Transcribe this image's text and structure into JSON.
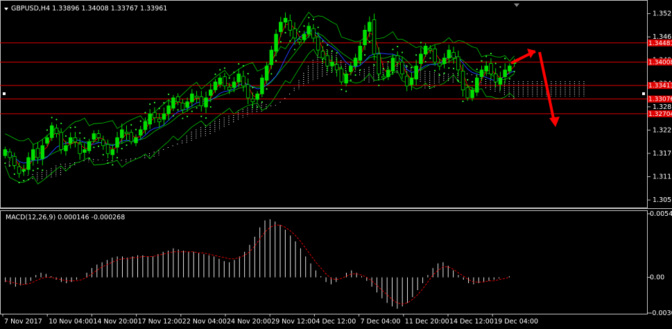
{
  "header": {
    "symbol_line": "GBPUSD,H4  1.33896 1.34008 1.33767 1.33961",
    "macd_line": "MACD(12,26,9) 0.000146 -0.000268"
  },
  "colors": {
    "background": "#000000",
    "frame": "#c8c8c8",
    "bull_candle": "#00e000",
    "bear_candle": "#000000",
    "candle_outline": "#00e000",
    "bollinger": "#00cc00",
    "parabolic_sar": "#33ff33",
    "ichimoku_cloud": "#f0f0f0",
    "ma_red": "#e00000",
    "ma_blue": "#2040ff",
    "level_lines": "#e00000",
    "level_tag_bg": "#e00000",
    "macd_hist": "#e8e8e8",
    "macd_signal": "#e00000",
    "arrows": "#ff0000"
  },
  "chart_data": [
    {
      "type": "candlestick",
      "title": "GBPUSD,H4",
      "ohlc_latest": {
        "open": 1.33896,
        "high": 1.34008,
        "low": 1.33767,
        "close": 1.33961
      },
      "y_ticks": [
        "1.35215",
        "1.34630",
        "1.34050",
        "1.33460",
        "1.32875",
        "1.32290",
        "1.31705",
        "1.31120",
        "1.30535"
      ],
      "ylim": [
        1.3038,
        1.3547
      ],
      "x_ticks": [
        "7 Nov 2017",
        "10 Nov 04:00",
        "14 Nov 20:00",
        "17 Nov 12:00",
        "22 Nov 04:00",
        "24 Nov 20:00",
        "29 Nov 12:00",
        "4 Dec 12:00",
        "7 Dec 04:00",
        "11 Dec 20:00",
        "14 Dec 12:00",
        "19 Dec 04:00"
      ],
      "horizontal_levels": [
        {
          "value": 1.3448,
          "label": "1.34481"
        },
        {
          "value": 1.34,
          "label": "1.34008"
        },
        {
          "value": 1.3341,
          "label": "1.33413"
        },
        {
          "value": 1.3307,
          "label": "1.33076"
        },
        {
          "value": 1.327,
          "label": "1.32704"
        }
      ],
      "close_path": [
        1.318,
        1.316,
        1.314,
        1.312,
        1.313,
        1.316,
        1.318,
        1.316,
        1.319,
        1.321,
        1.324,
        1.322,
        1.318,
        1.319,
        1.321,
        1.32,
        1.317,
        1.318,
        1.32,
        1.322,
        1.321,
        1.319,
        1.317,
        1.318,
        1.321,
        1.323,
        1.322,
        1.32,
        1.321,
        1.323,
        1.325,
        1.327,
        1.326,
        1.325,
        1.327,
        1.329,
        1.331,
        1.33,
        1.328,
        1.33,
        1.332,
        1.331,
        1.329,
        1.331,
        1.333,
        1.335,
        1.336,
        1.334,
        1.333,
        1.335,
        1.337,
        1.334,
        1.331,
        1.33,
        1.332,
        1.336,
        1.339,
        1.343,
        1.347,
        1.35,
        1.351,
        1.348,
        1.346,
        1.345,
        1.347,
        1.349,
        1.346,
        1.343,
        1.341,
        1.339,
        1.34,
        1.338,
        1.335,
        1.337,
        1.339,
        1.341,
        1.344,
        1.348,
        1.35,
        1.342,
        1.337,
        1.336,
        1.338,
        1.341,
        1.34,
        1.337,
        1.334,
        1.336,
        1.339,
        1.342,
        1.344,
        1.343,
        1.34,
        1.339,
        1.341,
        1.343,
        1.341,
        1.338,
        1.333,
        1.331,
        1.333,
        1.336,
        1.338,
        1.339,
        1.337,
        1.335,
        1.336,
        1.338,
        1.339,
        1.34
      ]
    },
    {
      "type": "bar",
      "title": "MACD(12,26,9)",
      "y_ticks": [
        "0.00547",
        "0.00",
        "-0.00307"
      ],
      "ylim": [
        -0.00307,
        0.00547
      ],
      "histogram": [
        -0.0004,
        -0.0006,
        -0.0008,
        -0.0007,
        -0.0006,
        -0.0003,
        0.0002,
        0.0004,
        0.0003,
        0.0001,
        -0.0002,
        -0.0004,
        -0.0005,
        -0.0004,
        -0.0002,
        0.0,
        0.0004,
        0.0008,
        0.0011,
        0.0013,
        0.0015,
        0.0017,
        0.0018,
        0.0018,
        0.0017,
        0.0018,
        0.0019,
        0.0019,
        0.0018,
        0.0018,
        0.002,
        0.0022,
        0.0023,
        0.0025,
        0.0024,
        0.0023,
        0.0022,
        0.0022,
        0.0021,
        0.002,
        0.0019,
        0.0018,
        0.0016,
        0.0014,
        0.0013,
        0.0015,
        0.0018,
        0.0022,
        0.0028,
        0.0035,
        0.0043,
        0.0049,
        0.005,
        0.0048,
        0.0045,
        0.0041,
        0.0036,
        0.0031,
        0.0025,
        0.0018,
        0.0012,
        0.0006,
        0.0001,
        -0.0004,
        -0.0006,
        -0.0004,
        0.0,
        0.0004,
        0.0006,
        0.0004,
        0.0001,
        -0.0003,
        -0.0008,
        -0.0013,
        -0.0018,
        -0.0022,
        -0.0025,
        -0.0027,
        -0.0025,
        -0.0022,
        -0.0017,
        -0.0011,
        -0.0005,
        0.0002,
        0.0008,
        0.0012,
        0.0013,
        0.001,
        0.0006,
        0.0002,
        -0.0002,
        -0.0005,
        -0.0006,
        -0.0005,
        -0.0004,
        -0.0003,
        -0.0002,
        -0.0001,
        0.0,
        0.0001
      ],
      "signal": [
        -0.0003,
        -0.0004,
        -0.0005,
        -0.0006,
        -0.0006,
        -0.0005,
        -0.0003,
        -0.0001,
        0.0,
        0.0,
        -0.0001,
        -0.0002,
        -0.0003,
        -0.0003,
        -0.0003,
        -0.0002,
        0.0,
        0.0003,
        0.0006,
        0.0009,
        0.0011,
        0.0013,
        0.0015,
        0.0016,
        0.0016,
        0.0017,
        0.0017,
        0.0018,
        0.0018,
        0.0018,
        0.0019,
        0.002,
        0.0021,
        0.0022,
        0.0022,
        0.0022,
        0.0022,
        0.0022,
        0.0021,
        0.0021,
        0.002,
        0.0019,
        0.0018,
        0.0017,
        0.0016,
        0.0016,
        0.0017,
        0.0019,
        0.0022,
        0.0027,
        0.0033,
        0.0039,
        0.0043,
        0.0045,
        0.0045,
        0.0043,
        0.004,
        0.0036,
        0.0031,
        0.0025,
        0.0019,
        0.0013,
        0.0008,
        0.0003,
        -0.0001,
        -0.0002,
        -0.0001,
        0.0001,
        0.0003,
        0.0003,
        0.0002,
        0.0,
        -0.0003,
        -0.0007,
        -0.0011,
        -0.0015,
        -0.0019,
        -0.0022,
        -0.0023,
        -0.0022,
        -0.0019,
        -0.0015,
        -0.001,
        -0.0004,
        0.0002,
        0.0006,
        0.0009,
        0.0009,
        0.0007,
        0.0004,
        0.0001,
        -0.0002,
        -0.0004,
        -0.0004,
        -0.0004,
        -0.0003,
        -0.0003,
        -0.0002,
        -0.0001,
        0.0
      ]
    }
  ]
}
